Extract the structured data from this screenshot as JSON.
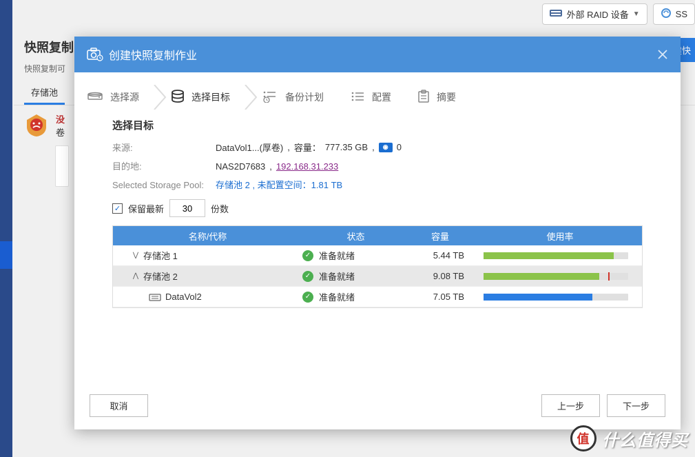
{
  "bg": {
    "toolbar": {
      "raid_label": "外部 RAID 设备",
      "ssd_label": "SS"
    },
    "title": "快照复制",
    "desc": "快照复制可",
    "tab": "存储池",
    "alert": {
      "line1": "没",
      "line2": "卷"
    },
    "corner_btn": "建快"
  },
  "modal": {
    "title": "创建快照复制作业",
    "steps": [
      {
        "label": "选择源"
      },
      {
        "label": "选择目标"
      },
      {
        "label": "备份计划"
      },
      {
        "label": "配置"
      },
      {
        "label": "摘要"
      }
    ],
    "section_title": "选择目标",
    "source": {
      "label": "来源:",
      "name": "DataVol1...(厚卷)",
      "cap_label": "容量：",
      "cap_value": "777.35 GB",
      "snap_count": "0"
    },
    "dest": {
      "label": "目的地:",
      "host": "NAS2D7683",
      "ip": "192.168.31.233"
    },
    "pool": {
      "label": "Selected Storage Pool:",
      "value": "存储池 2 , 未配置空间：1.81 TB"
    },
    "keep": {
      "label_prefix": "保留最新",
      "value": "30",
      "label_suffix": "份数"
    },
    "columns": {
      "name": "名称/代称",
      "status": "状态",
      "capacity": "容量",
      "usage": "使用率"
    },
    "rows": [
      {
        "indent": 28,
        "expand": "down",
        "name": "存储池 1",
        "status": "准备就绪",
        "capacity": "5.44 TB",
        "bar_color": "green",
        "bar_pct": 90,
        "tick": null
      },
      {
        "indent": 28,
        "expand": "up",
        "name": "存储池 2",
        "status": "准备就绪",
        "capacity": "9.08 TB",
        "bar_color": "green",
        "bar_pct": 80,
        "tick": 86,
        "selected": true
      },
      {
        "indent": 52,
        "expand": null,
        "icon": "volume",
        "name": "DataVol2",
        "status": "准备就绪",
        "capacity": "7.05 TB",
        "bar_color": "blue",
        "bar_pct": 75,
        "tick": null
      }
    ],
    "footer": {
      "cancel": "取消",
      "prev": "上一步",
      "next": "下一步"
    }
  },
  "watermark": {
    "logo": "值",
    "text": "什么值得买"
  }
}
